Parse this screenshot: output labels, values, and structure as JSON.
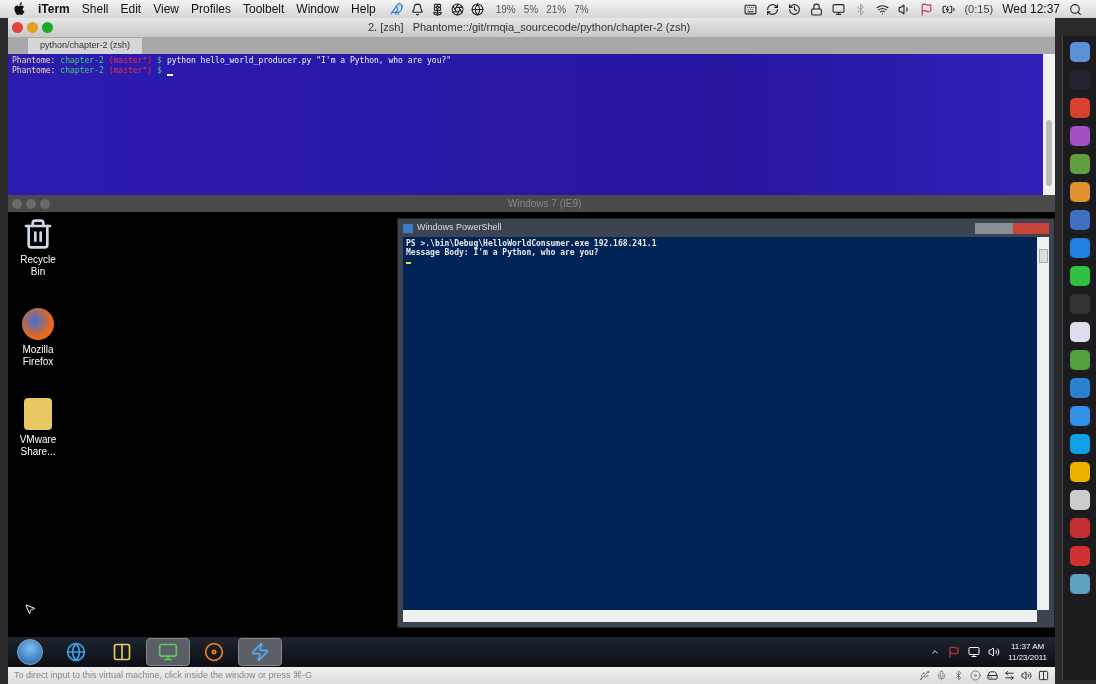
{
  "menubar": {
    "menus": [
      {
        "label": "iTerm",
        "bold": true
      },
      {
        "label": "Shell",
        "bold": false
      },
      {
        "label": "Edit",
        "bold": false
      },
      {
        "label": "View",
        "bold": false
      },
      {
        "label": "Profiles",
        "bold": false
      },
      {
        "label": "Toolbelt",
        "bold": false
      },
      {
        "label": "Window",
        "bold": false
      },
      {
        "label": "Help",
        "bold": false
      }
    ],
    "meters": [
      "19%",
      "5%",
      "21%",
      "7%"
    ],
    "battery_time": "(0:15)",
    "clock": "Wed 12:37"
  },
  "iterm": {
    "title": "2. [zsh]   Phantome::/git/rmqia_sourcecode/python/chapter-2 (zsh)",
    "tabs": [
      {
        "label": "python/chapter-2 (zsh)",
        "selected": true
      }
    ],
    "lines": [
      [
        {
          "kind": "host",
          "text": "Phantome:"
        },
        {
          "kind": "dir",
          "text": "chapter-2"
        },
        {
          "kind": "branch",
          "text": "(master*)"
        },
        {
          "kind": "symbol",
          "text": "$"
        },
        {
          "kind": "command",
          "text": "python hello_world_producer.py \"I'm a Python, who are you?\""
        }
      ],
      [
        {
          "kind": "host",
          "text": "Phantome:"
        },
        {
          "kind": "dir",
          "text": "chapter-2"
        },
        {
          "kind": "branch",
          "text": "(master*)"
        },
        {
          "kind": "symbol",
          "text": "$"
        },
        {
          "kind": "cursor"
        }
      ]
    ]
  },
  "vm": {
    "title": "Windows 7 (IE9)",
    "desktop_icons": [
      {
        "kind": "recycle",
        "label": "Recycle Bin"
      },
      {
        "kind": "firefox",
        "label": "Mozilla Firefox"
      },
      {
        "kind": "folder",
        "label": "VMware Share..."
      }
    ],
    "powershell": {
      "title": "Windows PowerShell",
      "lines": [
        "PS >.\\bin\\Debug\\HelloWorldConsumer.exe 192.168.241.1",
        "Message Body: I'm a Python, who are you?"
      ]
    },
    "taskbar": {
      "apps": [
        {
          "kind": "start",
          "selected": false
        },
        {
          "kind": "ie",
          "selected": false
        },
        {
          "kind": "explorer",
          "selected": false
        },
        {
          "kind": "csharp",
          "selected": true
        },
        {
          "kind": "media",
          "selected": false
        },
        {
          "kind": "powershell",
          "selected": true
        }
      ],
      "time": "11:37 AM",
      "date": "11/23/2011"
    },
    "status": "To direct input to this virtual machine, click inside the window or press ⌘-G"
  }
}
